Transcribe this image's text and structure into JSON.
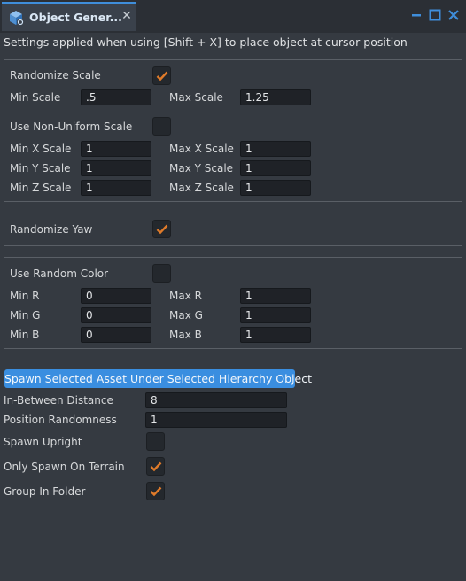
{
  "window": {
    "tab_title": "Object Gener...",
    "tab_close": "✕"
  },
  "description": "Settings applied when using [Shift + X] to place object at cursor position",
  "scale_group": {
    "randomize_scale_label": "Randomize Scale",
    "randomize_scale_checked": true,
    "min_scale_label": "Min Scale",
    "min_scale_value": ".5",
    "max_scale_label": "Max Scale",
    "max_scale_value": "1.25",
    "non_uniform_label": "Use Non-Uniform Scale",
    "non_uniform_checked": false,
    "min_x_label": "Min X Scale",
    "min_x_value": "1",
    "max_x_label": "Max X Scale",
    "max_x_value": "1",
    "min_y_label": "Min Y Scale",
    "min_y_value": "1",
    "max_y_label": "Max Y Scale",
    "max_y_value": "1",
    "min_z_label": "Min Z Scale",
    "min_z_value": "1",
    "max_z_label": "Max Z Scale",
    "max_z_value": "1"
  },
  "yaw_group": {
    "randomize_yaw_label": "Randomize Yaw",
    "randomize_yaw_checked": true
  },
  "color_group": {
    "use_random_color_label": "Use Random Color",
    "use_random_color_checked": false,
    "min_r_label": "Min R",
    "min_r_value": "0",
    "max_r_label": "Max R",
    "max_r_value": "1",
    "min_g_label": "Min G",
    "min_g_value": "0",
    "max_g_label": "Max G",
    "max_g_value": "1",
    "min_b_label": "Min B",
    "min_b_value": "0",
    "max_b_label": "Max B",
    "max_b_value": "1"
  },
  "spawn": {
    "button_label": "Spawn Selected Asset Under Selected Hierarchy Object",
    "in_between_label": "In-Between Distance",
    "in_between_value": "8",
    "position_randomness_label": "Position Randomness",
    "position_randomness_value": "1",
    "spawn_upright_label": "Spawn Upright",
    "spawn_upright_checked": false,
    "only_terrain_label": "Only Spawn On Terrain",
    "only_terrain_checked": true,
    "group_folder_label": "Group In Folder",
    "group_folder_checked": true
  },
  "colors": {
    "accent": "#3a8ee0",
    "check": "#e07b2a",
    "background": "#353a41"
  }
}
